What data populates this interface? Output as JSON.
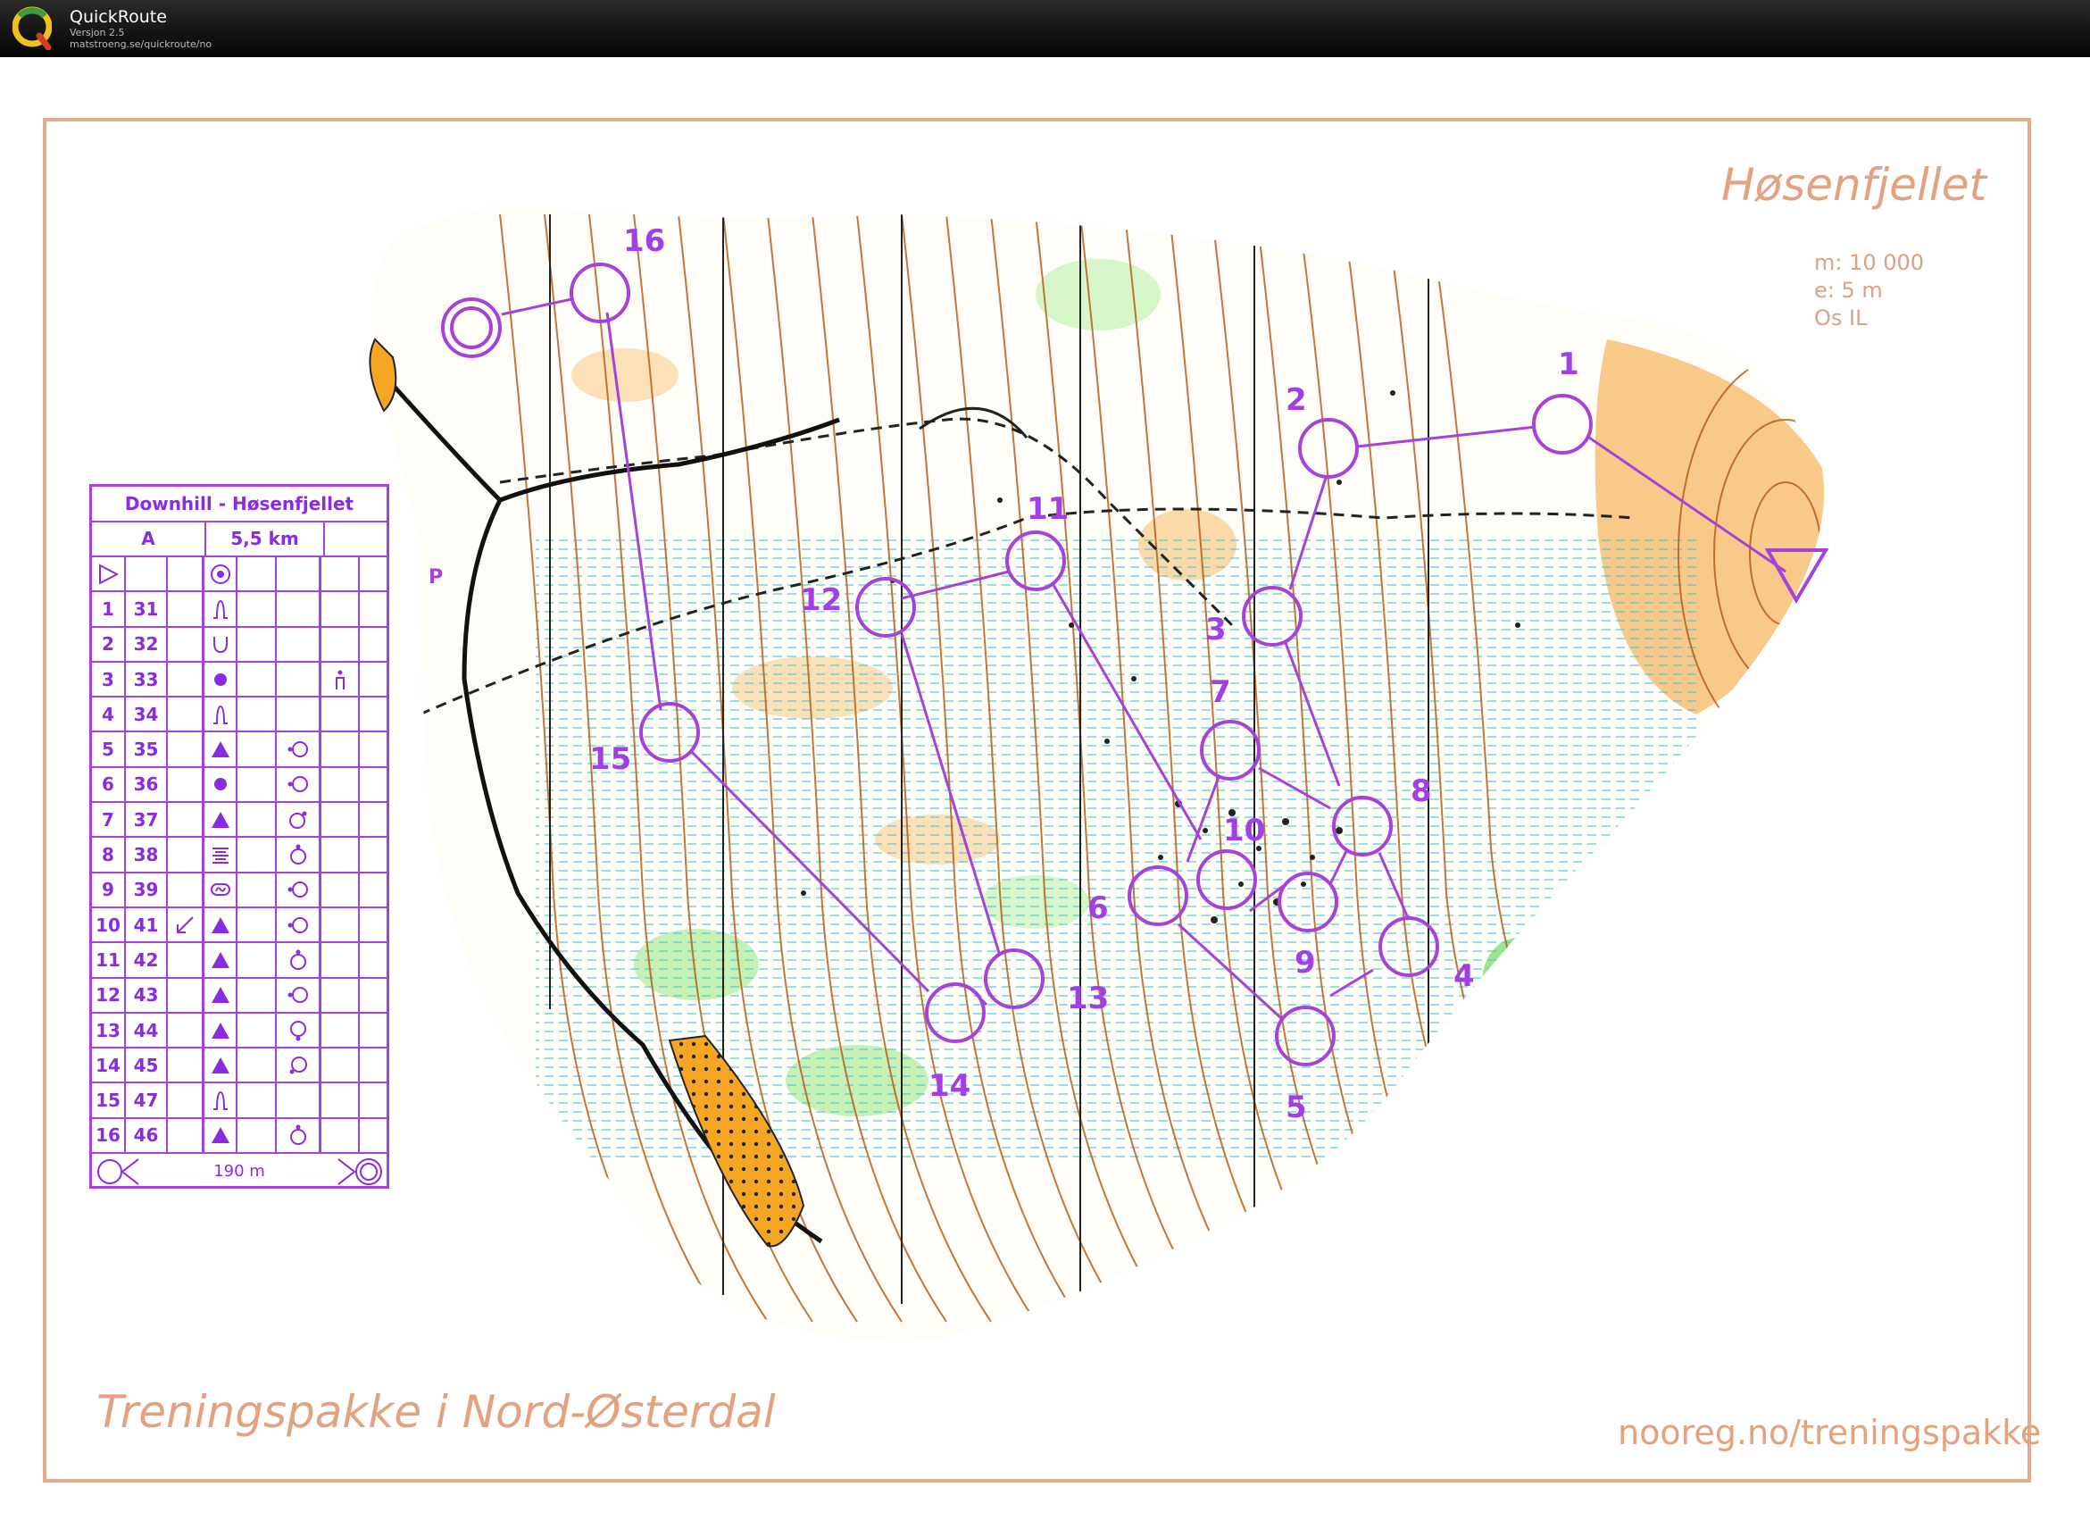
{
  "app": {
    "name": "QuickRoute",
    "version": "Versjon 2.5",
    "url": "matstroeng.se/quickroute/no"
  },
  "map": {
    "title": "Høsenfjellet",
    "scale": "m:  10 000",
    "equidistance": "e: 5 m",
    "club": "Os IL",
    "footer_left": "Treningspakke i Nord-Østerdal",
    "footer_right": "nooreg.no/treningspakke",
    "parking_symbol": "P",
    "colors": {
      "course": "#a742d8",
      "frame": "#e2a98a",
      "open_land": "#f9c98a",
      "contours": "#b85f1a",
      "water": "#3fc8d8"
    },
    "controls": [
      {
        "label": "1"
      },
      {
        "label": "2"
      },
      {
        "label": "3"
      },
      {
        "label": "4"
      },
      {
        "label": "5"
      },
      {
        "label": "6"
      },
      {
        "label": "7"
      },
      {
        "label": "8"
      },
      {
        "label": "9"
      },
      {
        "label": "10"
      },
      {
        "label": "11"
      },
      {
        "label": "12"
      },
      {
        "label": "13"
      },
      {
        "label": "14"
      },
      {
        "label": "15"
      },
      {
        "label": "16"
      }
    ]
  },
  "description": {
    "title": "Downhill - Høsenfjellet",
    "class": "A",
    "length": "5,5 km",
    "start_icon": "start-triangle-icon",
    "start_feature_icon": "ruined-structure-icon",
    "rows": [
      {
        "num": "1",
        "code": "31",
        "dir": "",
        "feature": "spur-icon",
        "loc": "",
        "side": ""
      },
      {
        "num": "2",
        "code": "32",
        "dir": "",
        "feature": "re-entrant-icon",
        "loc": "",
        "side": ""
      },
      {
        "num": "3",
        "code": "33",
        "dir": "",
        "feature": "boulder-icon",
        "loc": "",
        "side": "person-icon"
      },
      {
        "num": "4",
        "code": "34",
        "dir": "",
        "feature": "spur-icon",
        "loc": "",
        "side": ""
      },
      {
        "num": "5",
        "code": "35",
        "dir": "",
        "feature": "triangle-icon",
        "loc": "",
        "side": "west-side-icon"
      },
      {
        "num": "6",
        "code": "36",
        "dir": "",
        "feature": "boulder-icon",
        "loc": "",
        "side": "west-side-icon"
      },
      {
        "num": "7",
        "code": "37",
        "dir": "",
        "feature": "triangle-icon",
        "loc": "",
        "side": "north-east-side-icon"
      },
      {
        "num": "8",
        "code": "38",
        "dir": "",
        "feature": "marsh-icon",
        "loc": "",
        "side": "north-side-icon"
      },
      {
        "num": "9",
        "code": "39",
        "dir": "",
        "feature": "rough-open-icon",
        "loc": "",
        "side": "west-side-icon"
      },
      {
        "num": "10",
        "code": "41",
        "dir": "south-west-arrow-icon",
        "feature": "triangle-icon",
        "loc": "",
        "side": "west-side-icon"
      },
      {
        "num": "11",
        "code": "42",
        "dir": "",
        "feature": "triangle-icon",
        "loc": "",
        "side": "north-side-icon"
      },
      {
        "num": "12",
        "code": "43",
        "dir": "",
        "feature": "triangle-icon",
        "loc": "",
        "side": "west-side-icon"
      },
      {
        "num": "13",
        "code": "44",
        "dir": "",
        "feature": "triangle-icon",
        "loc": "",
        "side": "south-side-icon"
      },
      {
        "num": "14",
        "code": "45",
        "dir": "",
        "feature": "triangle-icon",
        "loc": "",
        "side": "south-west-side-icon"
      },
      {
        "num": "15",
        "code": "47",
        "dir": "",
        "feature": "spur-icon",
        "loc": "",
        "side": ""
      },
      {
        "num": "16",
        "code": "46",
        "dir": "",
        "feature": "triangle-icon",
        "loc": "",
        "side": "north-side-icon"
      }
    ],
    "finish_distance": "190 m"
  }
}
